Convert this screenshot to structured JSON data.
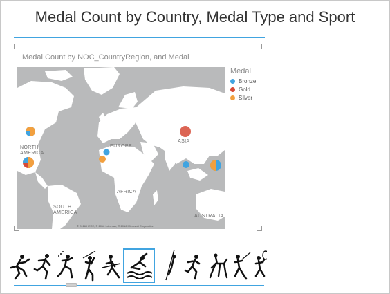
{
  "page": {
    "title": "Medal Count by Country, Medal Type and Sport"
  },
  "map_visual": {
    "title": "Medal Count by NOC_CountryRegion, and Medal",
    "region_labels": [
      "NORTH AMERICA",
      "SOUTH AMERICA",
      "EUROPE",
      "ASIA",
      "AFRICA",
      "AUSTRALIA"
    ],
    "attribution": "© 2016 HERE, © 2016 Intermap, © 2016 Microsoft Corporation"
  },
  "legend": {
    "title": "Medal",
    "items": [
      {
        "label": "Bronze",
        "color": "#41a4e0"
      },
      {
        "label": "Gold",
        "color": "#d64a36"
      },
      {
        "label": "Silver",
        "color": "#f2a03f"
      }
    ]
  },
  "colors": {
    "accent": "#41a4e0",
    "bronze": "#41a4e0",
    "gold": "#d64a36",
    "silver": "#f2a03f",
    "map_land": "#ffffff",
    "map_water": "#b9babb"
  },
  "sport_slicer": {
    "icons": [
      "athletics-hurdles-icon",
      "athletics-running-icon",
      "gymnastics-icon",
      "javelin-icon",
      "weightlifting-icon",
      "swimming-icon",
      "ski-jumping-icon",
      "running-icon",
      "equestrian-icon",
      "fencing-icon",
      "tennis-icon"
    ],
    "selected_index": 5
  }
}
